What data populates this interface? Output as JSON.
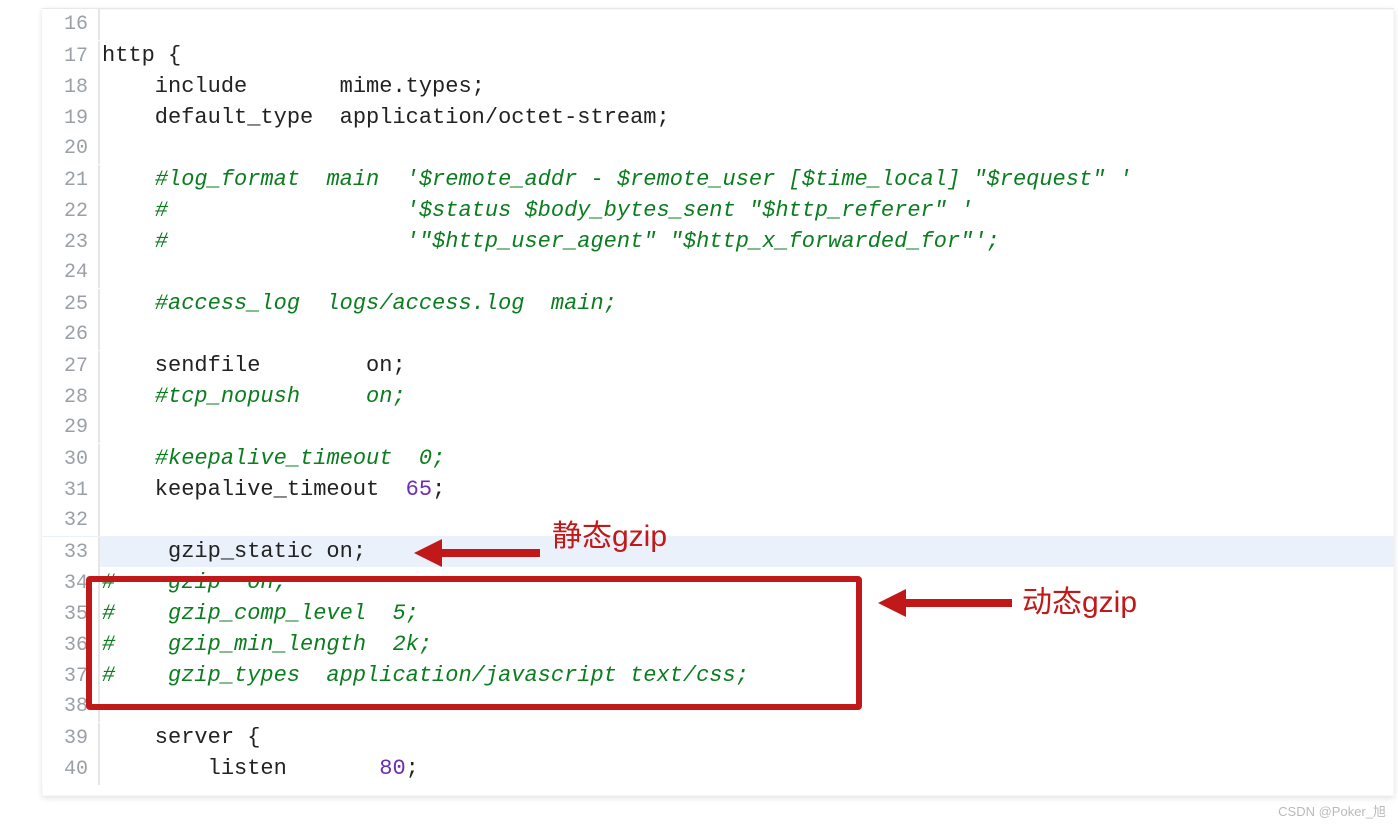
{
  "lines": [
    {
      "num": 16,
      "tokens": []
    },
    {
      "num": 17,
      "tokens": [
        {
          "t": "http ",
          "c": "plain"
        },
        {
          "t": "{",
          "c": "punc"
        }
      ]
    },
    {
      "num": 18,
      "tokens": [
        {
          "t": "    include       mime",
          "c": "plain"
        },
        {
          "t": ".",
          "c": "punc"
        },
        {
          "t": "types",
          "c": "plain"
        },
        {
          "t": ";",
          "c": "punc"
        }
      ]
    },
    {
      "num": 19,
      "tokens": [
        {
          "t": "    default_type  application",
          "c": "plain"
        },
        {
          "t": "/",
          "c": "punc"
        },
        {
          "t": "octet",
          "c": "plain"
        },
        {
          "t": "-",
          "c": "punc"
        },
        {
          "t": "stream",
          "c": "plain"
        },
        {
          "t": ";",
          "c": "punc"
        }
      ]
    },
    {
      "num": 20,
      "tokens": []
    },
    {
      "num": 21,
      "tokens": [
        {
          "t": "    ",
          "c": "plain"
        },
        {
          "t": "#log_format  main  '$remote_addr - $remote_user [$time_local] \"$request\" '",
          "c": "comment"
        }
      ]
    },
    {
      "num": 22,
      "tokens": [
        {
          "t": "    ",
          "c": "plain"
        },
        {
          "t": "#                  '$status $body_bytes_sent \"$http_referer\" '",
          "c": "comment"
        }
      ]
    },
    {
      "num": 23,
      "tokens": [
        {
          "t": "    ",
          "c": "plain"
        },
        {
          "t": "#                  '\"$http_user_agent\" \"$http_x_forwarded_for\"';",
          "c": "comment"
        }
      ]
    },
    {
      "num": 24,
      "tokens": []
    },
    {
      "num": 25,
      "tokens": [
        {
          "t": "    ",
          "c": "plain"
        },
        {
          "t": "#access_log  logs/access.log  main;",
          "c": "comment"
        }
      ]
    },
    {
      "num": 26,
      "tokens": []
    },
    {
      "num": 27,
      "tokens": [
        {
          "t": "    sendfile        on",
          "c": "plain"
        },
        {
          "t": ";",
          "c": "punc"
        }
      ]
    },
    {
      "num": 28,
      "tokens": [
        {
          "t": "    ",
          "c": "plain"
        },
        {
          "t": "#tcp_nopush     on;",
          "c": "comment"
        }
      ]
    },
    {
      "num": 29,
      "tokens": []
    },
    {
      "num": 30,
      "tokens": [
        {
          "t": "    ",
          "c": "plain"
        },
        {
          "t": "#keepalive_timeout  0;",
          "c": "comment"
        }
      ]
    },
    {
      "num": 31,
      "tokens": [
        {
          "t": "    keepalive_timeout  ",
          "c": "plain"
        },
        {
          "t": "65",
          "c": "num"
        },
        {
          "t": ";",
          "c": "punc"
        }
      ]
    },
    {
      "num": 32,
      "tokens": []
    },
    {
      "num": 33,
      "hl": true,
      "tokens": [
        {
          "t": "     gzip_static on",
          "c": "plain"
        },
        {
          "t": ";",
          "c": "punc"
        }
      ]
    },
    {
      "num": 34,
      "tokens": [
        {
          "t": "",
          "c": "plain"
        },
        {
          "t": "#    gzip  on;",
          "c": "comment"
        }
      ]
    },
    {
      "num": 35,
      "tokens": [
        {
          "t": "",
          "c": "plain"
        },
        {
          "t": "#    gzip_comp_level  5;",
          "c": "comment"
        }
      ]
    },
    {
      "num": 36,
      "tokens": [
        {
          "t": "",
          "c": "plain"
        },
        {
          "t": "#    gzip_min_length  2k;",
          "c": "comment"
        }
      ]
    },
    {
      "num": 37,
      "tokens": [
        {
          "t": "",
          "c": "plain"
        },
        {
          "t": "#    gzip_types  application/javascript text/css;",
          "c": "comment"
        }
      ]
    },
    {
      "num": 38,
      "tokens": []
    },
    {
      "num": 39,
      "tokens": [
        {
          "t": "    server ",
          "c": "plain"
        },
        {
          "t": "{",
          "c": "punc"
        }
      ]
    },
    {
      "num": 40,
      "tokens": [
        {
          "t": "        listen       ",
          "c": "plain"
        },
        {
          "t": "80",
          "c": "num"
        },
        {
          "t": ";",
          "c": "punc"
        }
      ]
    }
  ],
  "annotations": {
    "static_label": "静态gzip",
    "dynamic_label": "动态gzip"
  },
  "watermark": "CSDN @Poker_旭"
}
